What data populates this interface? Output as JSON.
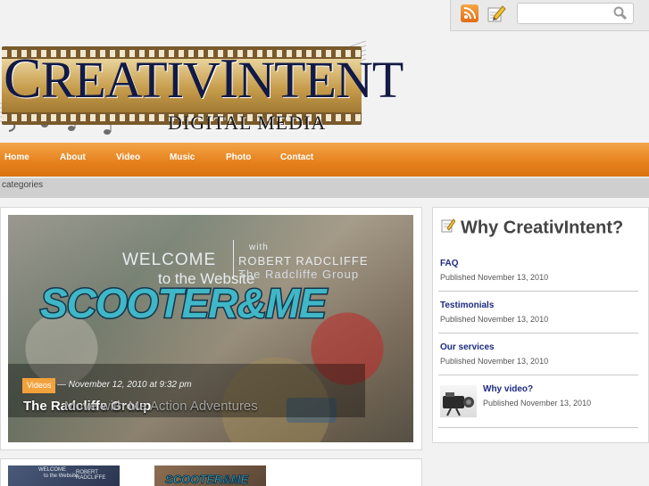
{
  "search": {
    "placeholder": "",
    "value": ""
  },
  "utility": {
    "rss_icon": "rss-icon",
    "edit_icon": "edit-icon",
    "search_icon": "search-icon"
  },
  "logo": {
    "title_first": "C",
    "title_rest1": "REATIV",
    "title_i": "I",
    "title_rest2": "NTENT",
    "subtitle": "DIGITAL MEDIA"
  },
  "nav": {
    "items": [
      "Home",
      "About",
      "Video",
      "Music",
      "Photo",
      "Contact"
    ]
  },
  "categories": {
    "label": "categories"
  },
  "feature": {
    "banner": {
      "welcome": "WELCOME",
      "to_website": "to the Website",
      "with": "with",
      "name": "ROBERT RADCLIFFE",
      "group": "The Radcliffe Group",
      "show": "SCOOTER&ME"
    },
    "category": "Videos",
    "date": "— November 12, 2010 at 9:32 pm",
    "title": "The Radcliffe Group",
    "title_overlap": "Move with Me Action Adventures"
  },
  "thumbs": [
    {
      "welcome": "WELCOME",
      "sub": "to the Website",
      "name": "ROBERT RADCLIFFE"
    },
    {
      "show": "SCOOTER&ME"
    }
  ],
  "sidebar": {
    "heading": "Why CreativIntent?",
    "entries": [
      {
        "title": "FAQ",
        "published": "Published November 13, 2010"
      },
      {
        "title": "Testimonials",
        "published": "Published November 13, 2010"
      },
      {
        "title": "Our services",
        "published": "Published November 13, 2010"
      },
      {
        "title": "Why video?",
        "published": "Published November 13, 2010"
      }
    ]
  },
  "colors": {
    "nav": "#e5801b",
    "accent": "#f2a23c",
    "link": "#1c2a80"
  }
}
